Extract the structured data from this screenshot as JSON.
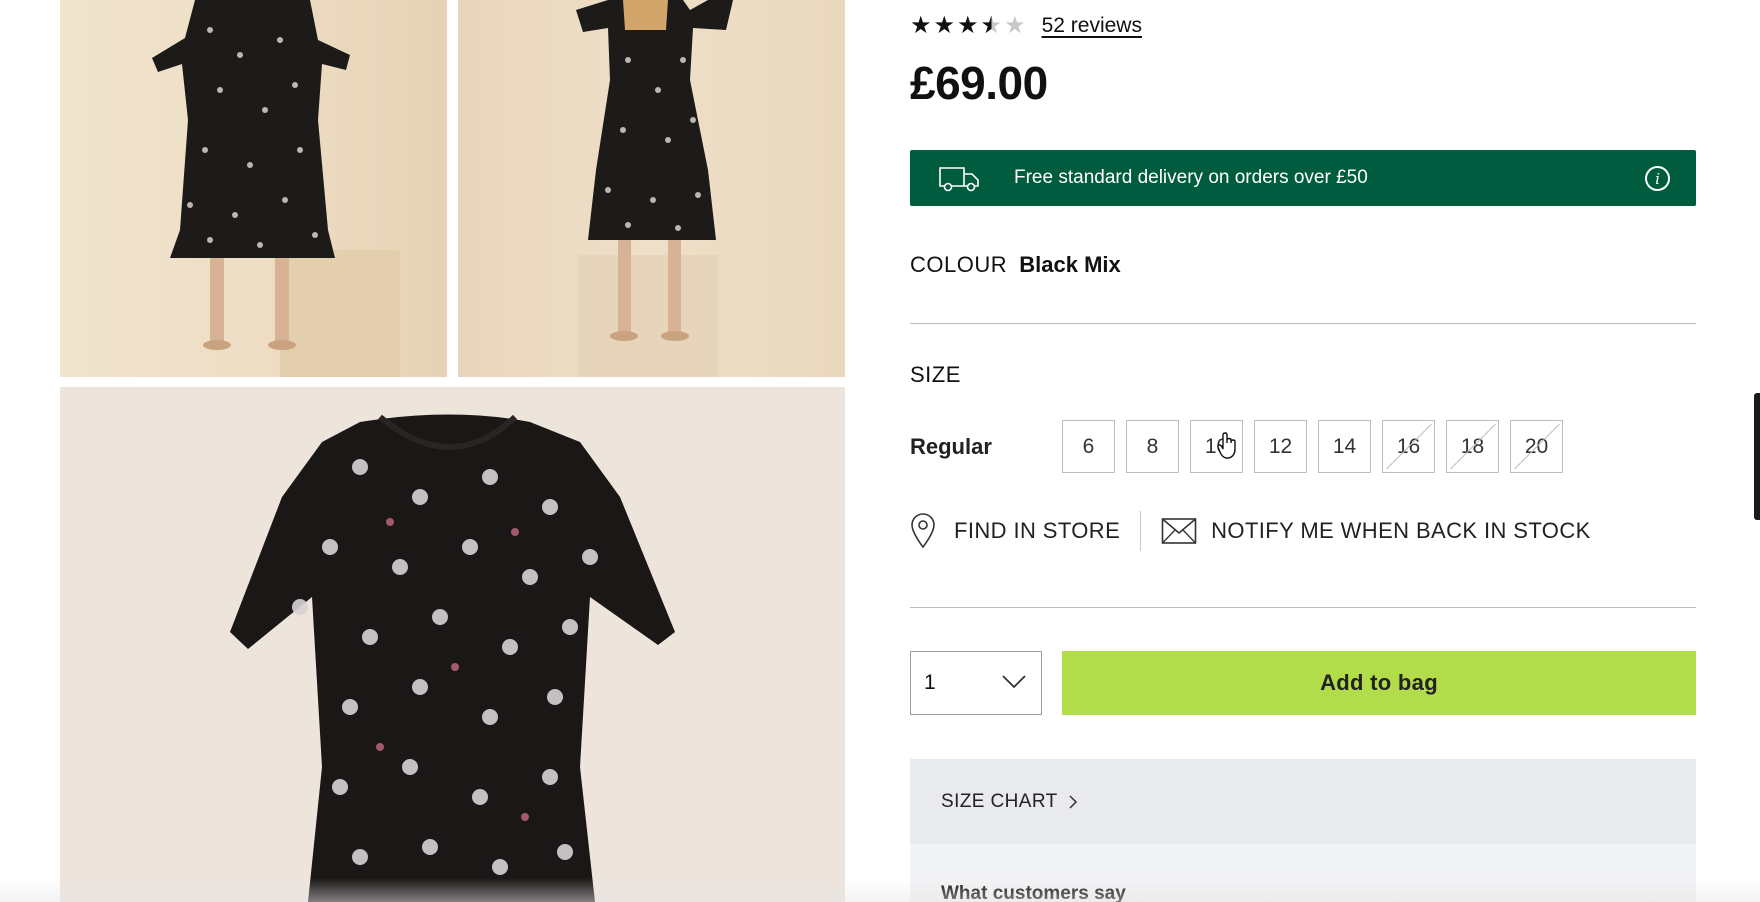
{
  "product": {
    "rating": 3.5,
    "rating_max": 5,
    "reviews_link": "52 reviews",
    "price": "£69.00"
  },
  "delivery": {
    "text": "Free standard delivery on orders over £50",
    "info_glyph": "i",
    "icon": "delivery-van-icon",
    "color": "#005c3e"
  },
  "colour": {
    "label": "COLOUR",
    "value": "Black Mix"
  },
  "size": {
    "heading": "SIZE",
    "fit_label": "Regular",
    "options": [
      {
        "label": "6",
        "in_stock": true
      },
      {
        "label": "8",
        "in_stock": true
      },
      {
        "label": "10",
        "in_stock": true
      },
      {
        "label": "12",
        "in_stock": true
      },
      {
        "label": "14",
        "in_stock": true
      },
      {
        "label": "16",
        "in_stock": false
      },
      {
        "label": "18",
        "in_stock": false
      },
      {
        "label": "20",
        "in_stock": false
      }
    ]
  },
  "store_actions": {
    "find_in_store": "FIND IN STORE",
    "notify": "NOTIFY ME WHEN BACK IN STOCK"
  },
  "purchase": {
    "quantity": "1",
    "add_to_bag": "Add to bag",
    "button_color": "#b1dd4a"
  },
  "panels": {
    "size_chart": "SIZE CHART",
    "customers_say": "What customers say"
  }
}
